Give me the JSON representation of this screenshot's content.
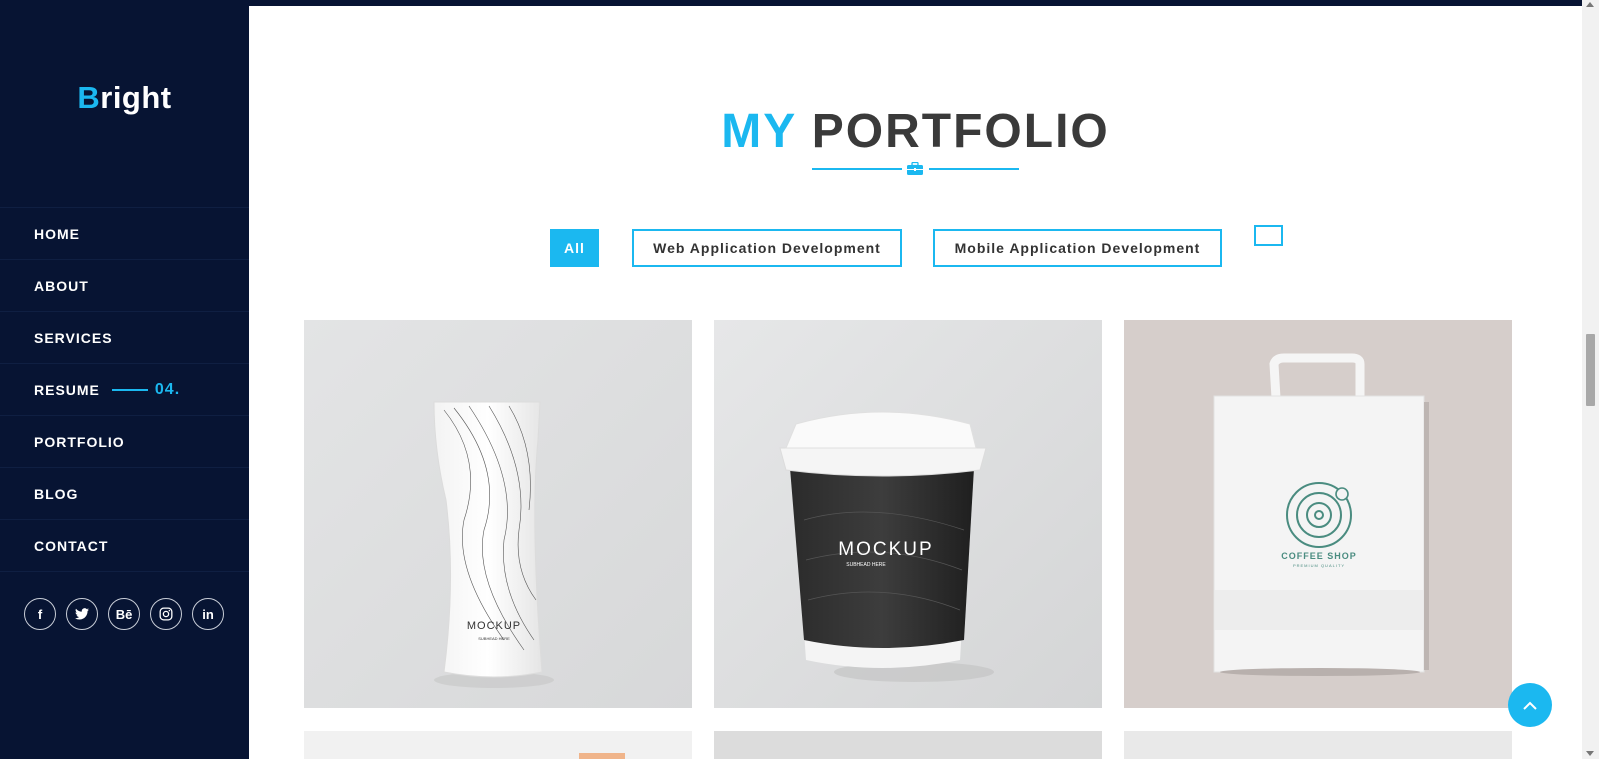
{
  "brand": {
    "first_letter": "B",
    "rest": "right"
  },
  "nav": {
    "items": [
      {
        "label": "HOME"
      },
      {
        "label": "ABOUT"
      },
      {
        "label": "SERVICES"
      },
      {
        "label": "RESUME",
        "number": "04."
      },
      {
        "label": "PORTFOLIO"
      },
      {
        "label": "BLOG"
      },
      {
        "label": "CONTACT"
      }
    ]
  },
  "socials": [
    {
      "icon": "facebook-icon",
      "glyph": "f"
    },
    {
      "icon": "twitter-icon",
      "glyph": "🐦"
    },
    {
      "icon": "behance-icon",
      "glyph": "Bē"
    },
    {
      "icon": "instagram-icon",
      "glyph": "◎"
    },
    {
      "icon": "linkedin-icon",
      "glyph": "in"
    }
  ],
  "section": {
    "title_accent": "MY",
    "title_rest": "PORTFOLIO"
  },
  "filters": {
    "items": [
      {
        "label": "All",
        "active": true
      },
      {
        "label": "Web Application Development",
        "active": false
      },
      {
        "label": "Mobile Application Development",
        "active": false
      },
      {
        "label": "",
        "active": false
      }
    ]
  },
  "portfolio": {
    "items": [
      {
        "image": "pouch mockup",
        "text": "MOCKUP",
        "sub": "SUBHEAD HERE"
      },
      {
        "image": "coffee cup mockup",
        "text": "MOCKUP",
        "sub": "SUBHEAD HERE"
      },
      {
        "image": "paper bag mockup",
        "text": "COFFEE SHOP",
        "sub": "PREMIUM QUALITY"
      }
    ]
  },
  "colors": {
    "accent": "#1bb8f0",
    "sidebar": "#071433",
    "title_dark": "#3a3a3a"
  }
}
